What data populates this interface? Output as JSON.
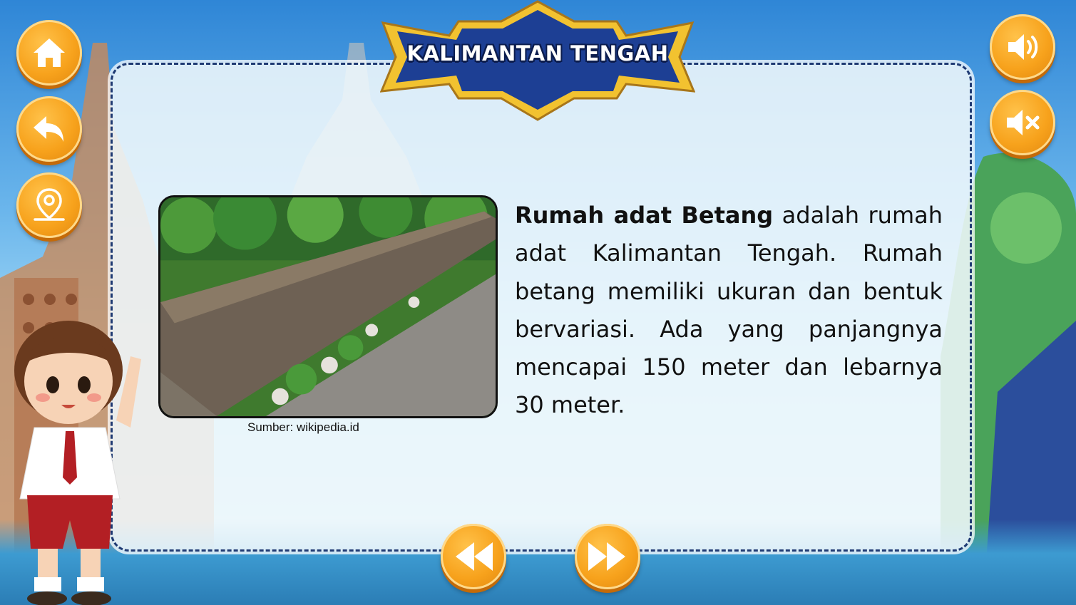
{
  "header": {
    "title": "KALIMANTAN TENGAH"
  },
  "left_toolbar": [
    {
      "name": "home-button",
      "icon": "home-icon"
    },
    {
      "name": "back-button",
      "icon": "back-arrow-icon"
    },
    {
      "name": "map-button",
      "icon": "location-pin-icon"
    }
  ],
  "right_toolbar": [
    {
      "name": "sound-on-button",
      "icon": "speaker-on-icon"
    },
    {
      "name": "mute-button",
      "icon": "speaker-mute-icon"
    }
  ],
  "content": {
    "bold_lead": "Rumah adat Betang",
    "body_text": " adalah rumah adat Kalimantan Tengah. Rumah betang memiliki ukuran dan bentuk bervariasi. Ada yang panjangnya mencapai 150 meter dan lebarnya 30 meter.",
    "image_caption": "Sumber: wikipedia.id",
    "image_subject": "Rumah Betang longhouse aerial photo"
  },
  "navigation": {
    "prev_icon": "rewind-icon",
    "next_icon": "fast-forward-icon"
  },
  "colors": {
    "button_orange": "#f7a21c",
    "banner_blue": "#1d3f94",
    "banner_gold": "#f2c230",
    "panel_border": "#1f3a73"
  }
}
